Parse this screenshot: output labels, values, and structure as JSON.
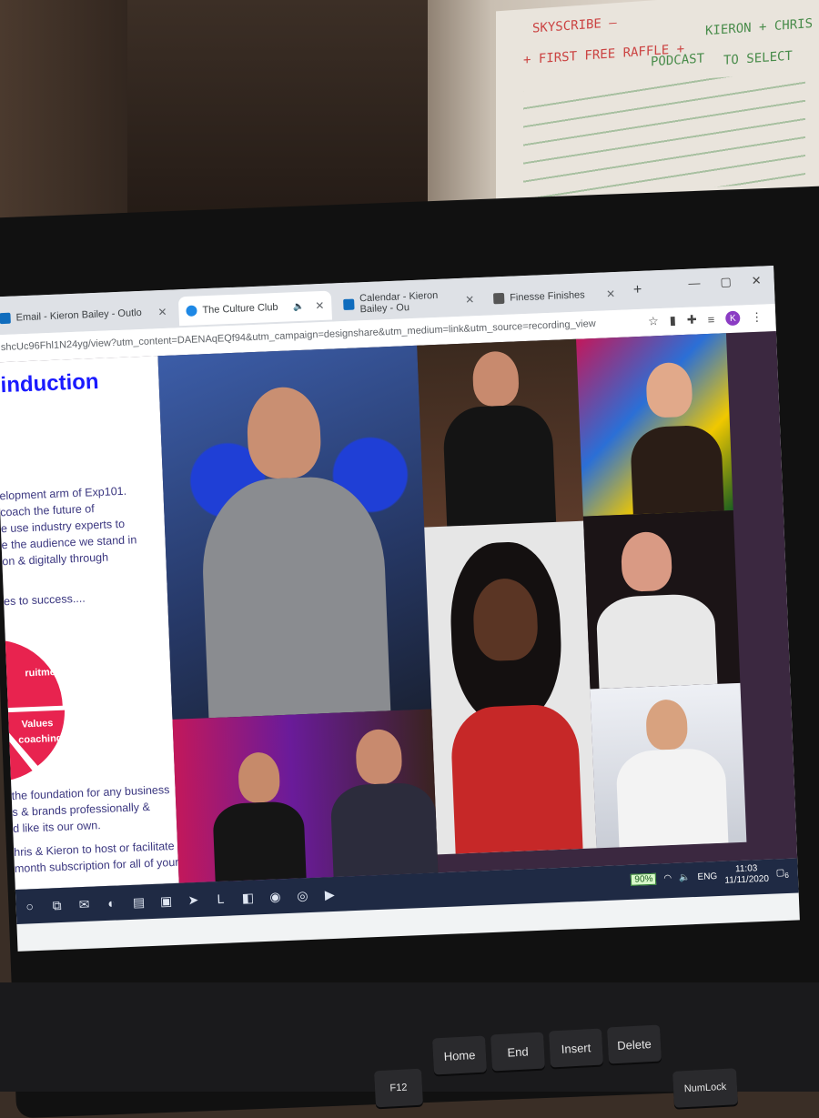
{
  "whiteboard": {
    "lines": [
      "SKYSCRIBE —",
      "+ FIRST FREE RAFFLE +",
      "KIERON + CHRIS",
      "PODCAST",
      "TO SELECT"
    ]
  },
  "browser": {
    "tabs": [
      {
        "label": "Email - Kieron Bailey - Outlo",
        "icon": "outlook-icon",
        "color": "#0f6cbd"
      },
      {
        "label": "The Culture Club",
        "icon": "canva-icon",
        "color": "#1e88e5"
      },
      {
        "label": "Calendar - Kieron Bailey - Ou",
        "icon": "calendar-icon",
        "color": "#0f6cbd"
      },
      {
        "label": "Finesse Finishes",
        "icon": "cube-icon",
        "color": "#555555"
      }
    ],
    "new_tab_label": "+",
    "window_controls": [
      "—",
      "▢",
      "✕"
    ],
    "url": "shcUc96Fhl1N24yg/view?utm_content=DAENAqEQf94&utm_campaign=designshare&utm_medium=link&utm_source=recording_view",
    "profile_initial": "K"
  },
  "page": {
    "heading": "induction",
    "paragraph_lines": [
      "elopment arm of Exp101.",
      "coach the future of",
      "e use industry experts to",
      "e the audience we stand in",
      "on & digitally through"
    ],
    "success_line": "es to success....",
    "pie_labels": [
      "ruitment",
      "Values",
      "coaching"
    ],
    "footer_lines": [
      "the foundation for any business",
      "s & brands professionally &",
      "d like its our own.",
      "hris & Kieron to host or facilitate .",
      "month subscription for all of your"
    ],
    "pie_color": "#e8234f"
  },
  "taskbar": {
    "battery": "90%",
    "language": "ENG",
    "time": "11:03",
    "date": "11/11/2020",
    "notification_count": "6"
  },
  "keyboard": {
    "keys": [
      "Home",
      "End",
      "Insert",
      "Delete",
      "NumLock",
      "F12"
    ]
  }
}
